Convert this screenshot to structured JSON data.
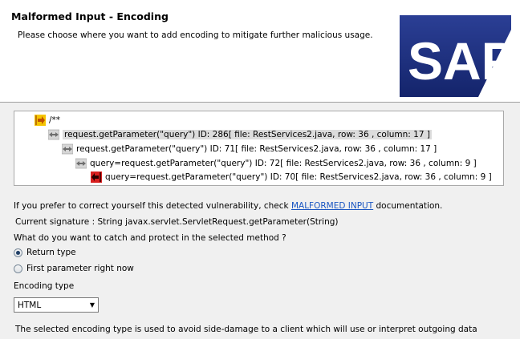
{
  "header": {
    "title": "Malformed Input - Encoding",
    "description": "Please choose where you want to add encoding to mitigate further malicious usage.",
    "logo_text": "SAP"
  },
  "tree": {
    "nodes": [
      {
        "label": "/**",
        "icon": "entry-arrow-icon"
      },
      {
        "label": "request.getParameter(\"query\") ID: 286[ file: RestServices2.java, row: 36 , column: 17 ]",
        "icon": "flow-arrows-icon"
      },
      {
        "label": "request.getParameter(\"query\") ID: 71[ file: RestServices2.java, row: 36 , column: 17 ]",
        "icon": "flow-arrows-icon"
      },
      {
        "label": "query=request.getParameter(\"query\") ID: 72[ file: RestServices2.java, row: 36 , column: 9 ]",
        "icon": "flow-arrows-icon"
      },
      {
        "label": "query=request.getParameter(\"query\") ID: 70[ file: RestServices2.java, row: 36 , column: 9 ]",
        "icon": "sink-arrow-icon"
      }
    ]
  },
  "info": {
    "prefix": "If you prefer to correct yourself this detected vulnerability, check ",
    "link": "MALFORMED INPUT",
    "suffix": " documentation.",
    "signature": "Current signature : String javax.servlet.ServletRequest.getParameter(String)",
    "question": "What do you want to catch and protect in the selected method ?"
  },
  "options": [
    {
      "label": "Return type",
      "selected": true
    },
    {
      "label": "First parameter right now",
      "selected": false
    }
  ],
  "encoding": {
    "label": "Encoding type",
    "selected": "HTML",
    "note": "The selected encoding type is used to avoid side-damage to a client which will use or interpret outgoing data"
  },
  "colors": {
    "logo_blue": "#1b2f7e",
    "entry_yellow": "#f5c400",
    "sink_red": "#d81e1e",
    "link_blue": "#1a56c2"
  }
}
